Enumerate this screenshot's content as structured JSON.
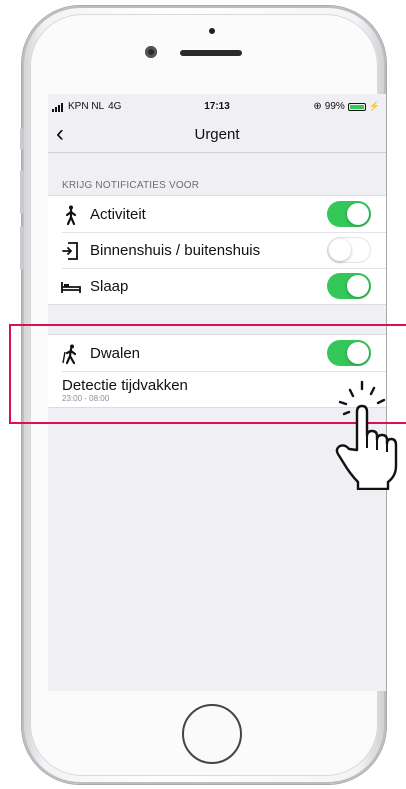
{
  "status_bar": {
    "carrier": "KPN NL",
    "network": "4G",
    "time": "17:13",
    "battery": "99%"
  },
  "nav": {
    "back_label": "‹",
    "title": "Urgent"
  },
  "section": {
    "header": "KRIJG NOTIFICATIES VOOR",
    "items": [
      {
        "label": "Activiteit",
        "icon": "walking-person-icon",
        "enabled": true
      },
      {
        "label": "Binnenshuis / buitenshuis",
        "icon": "door-exit-icon",
        "enabled": false
      },
      {
        "label": "Slaap",
        "icon": "bed-icon",
        "enabled": true
      }
    ]
  },
  "wander": {
    "label": "Dwalen",
    "icon": "hiker-icon",
    "enabled": true,
    "period_label": "Detectie tijdvakken",
    "period_value": "23:00 - 08:00"
  },
  "colors": {
    "toggle_on": "#34c759",
    "highlight": "#d9124f",
    "background": "#efeff4"
  }
}
